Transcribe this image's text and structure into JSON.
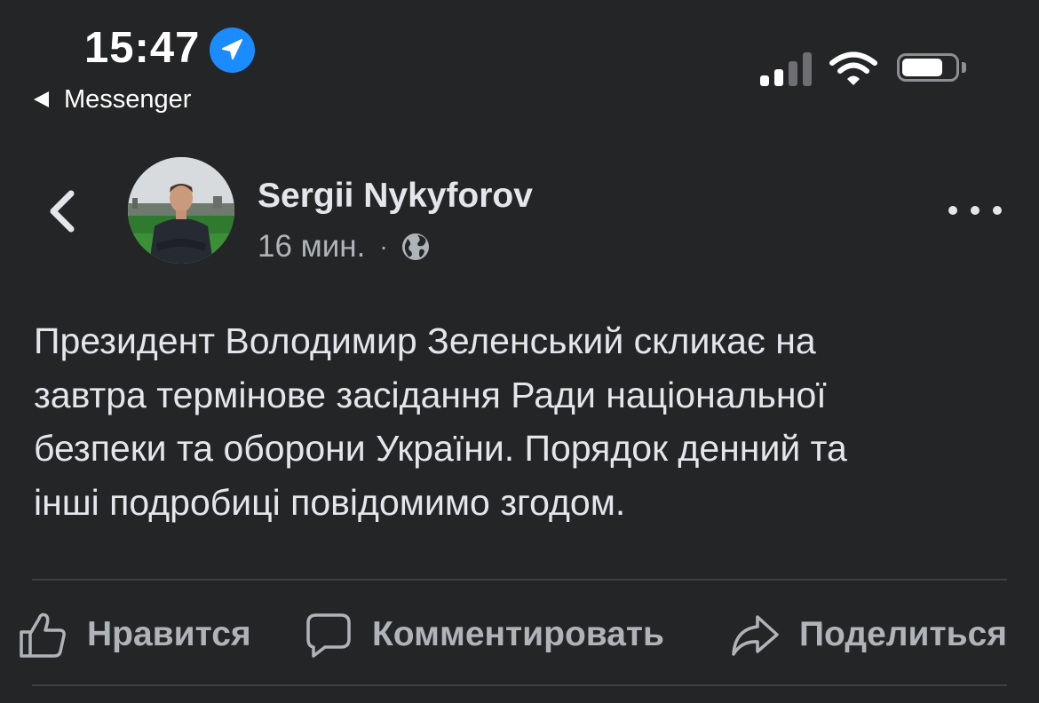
{
  "status_bar": {
    "time": "15:47",
    "back_app": "Messenger",
    "icons": [
      "location-arrow-icon",
      "cellular-signal-icon",
      "wifi-icon",
      "battery-icon"
    ]
  },
  "post": {
    "author": "Sergii Nykyforov",
    "time_ago": "16 мин.",
    "separator": "·",
    "audience_icon": "globe-icon",
    "lines": [
      "Президент Володимир Зеленський скликає на",
      "завтра термінове засідання Ради національної",
      "безпеки та оборони України. Порядок денний та",
      "інші подробиці повідомимо згодом."
    ]
  },
  "actions": {
    "like": "Нравится",
    "comment": "Комментировать",
    "share": "Поделиться"
  },
  "colors": {
    "background": "#242526",
    "text_primary": "#e4e6eb",
    "text_secondary": "#b0b3b8",
    "divider": "#3e4042",
    "location_badge": "#1a8cff"
  }
}
